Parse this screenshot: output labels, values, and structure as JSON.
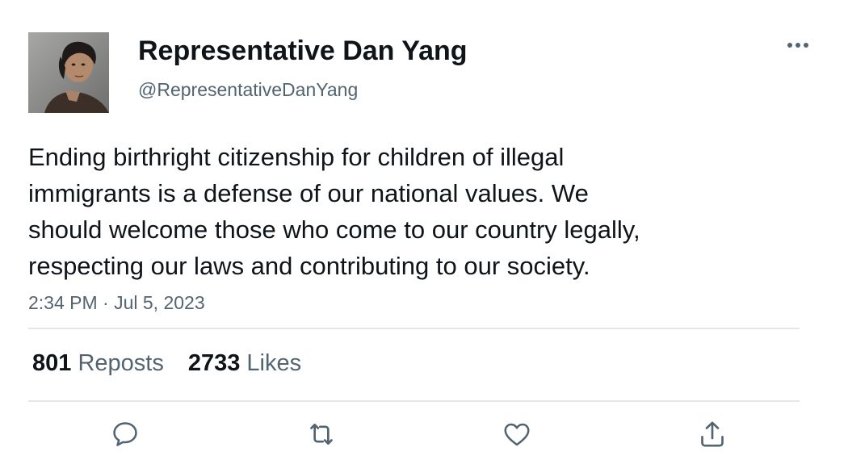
{
  "author": {
    "display_name": "Representative Dan Yang",
    "handle": "@RepresentativeDanYang"
  },
  "tweet": {
    "text": "Ending birthright citizenship for children of illegal\nimmigrants is a defense of our national values. We\nshould welcome those who come to our country legally,\nrespecting our laws and contributing to our society.",
    "timestamp": "2:34 PM · Jul 5, 2023"
  },
  "stats": {
    "reposts_count": "801",
    "reposts_label": "Reposts",
    "likes_count": "2733",
    "likes_label": "Likes"
  },
  "icons": {
    "more": "more-dots-icon",
    "reply": "reply-bubble-icon",
    "repost": "repost-arrows-icon",
    "like": "heart-icon",
    "share": "share-upload-icon"
  },
  "colors": {
    "text_primary": "#0f1419",
    "text_secondary": "#536471",
    "divider": "#e6e6e6",
    "icon": "#536471"
  }
}
